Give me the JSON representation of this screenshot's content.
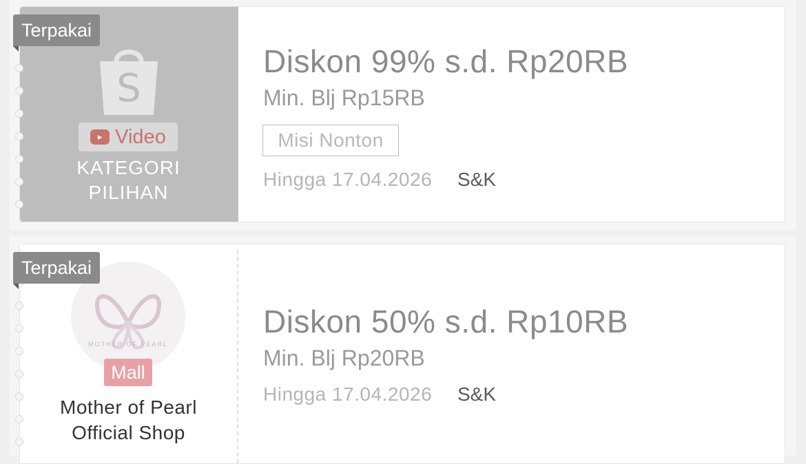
{
  "vouchers": [
    {
      "status": "Terpakai",
      "category_video": "Video",
      "category_line1": "KATEGORI",
      "category_line2": "PILIHAN",
      "title": "Diskon 99% s.d. Rp20RB",
      "min_purchase": "Min. Blj Rp15RB",
      "tag": "Misi Nonton",
      "valid_until": "Hingga 17.04.2026",
      "terms": "S&K"
    },
    {
      "status": "Terpakai",
      "logo_caption": "MOTHER OF PEARL",
      "mall_badge": "Mall",
      "shop_line1": "Mother of Pearl",
      "shop_line2": "Official Shop",
      "title": "Diskon 50% s.d. Rp10RB",
      "min_purchase": "Min. Blj Rp20RB",
      "valid_until": "Hingga 17.04.2026",
      "terms": "S&K"
    }
  ],
  "icons": {
    "bag": "shopee-bag-icon",
    "video": "play-icon",
    "logo": "butterfly-logo-icon"
  },
  "colors": {
    "used_badge": "#8a8a8a",
    "mall_badge": "#e8a0a7",
    "video_accent": "#c9746b"
  }
}
